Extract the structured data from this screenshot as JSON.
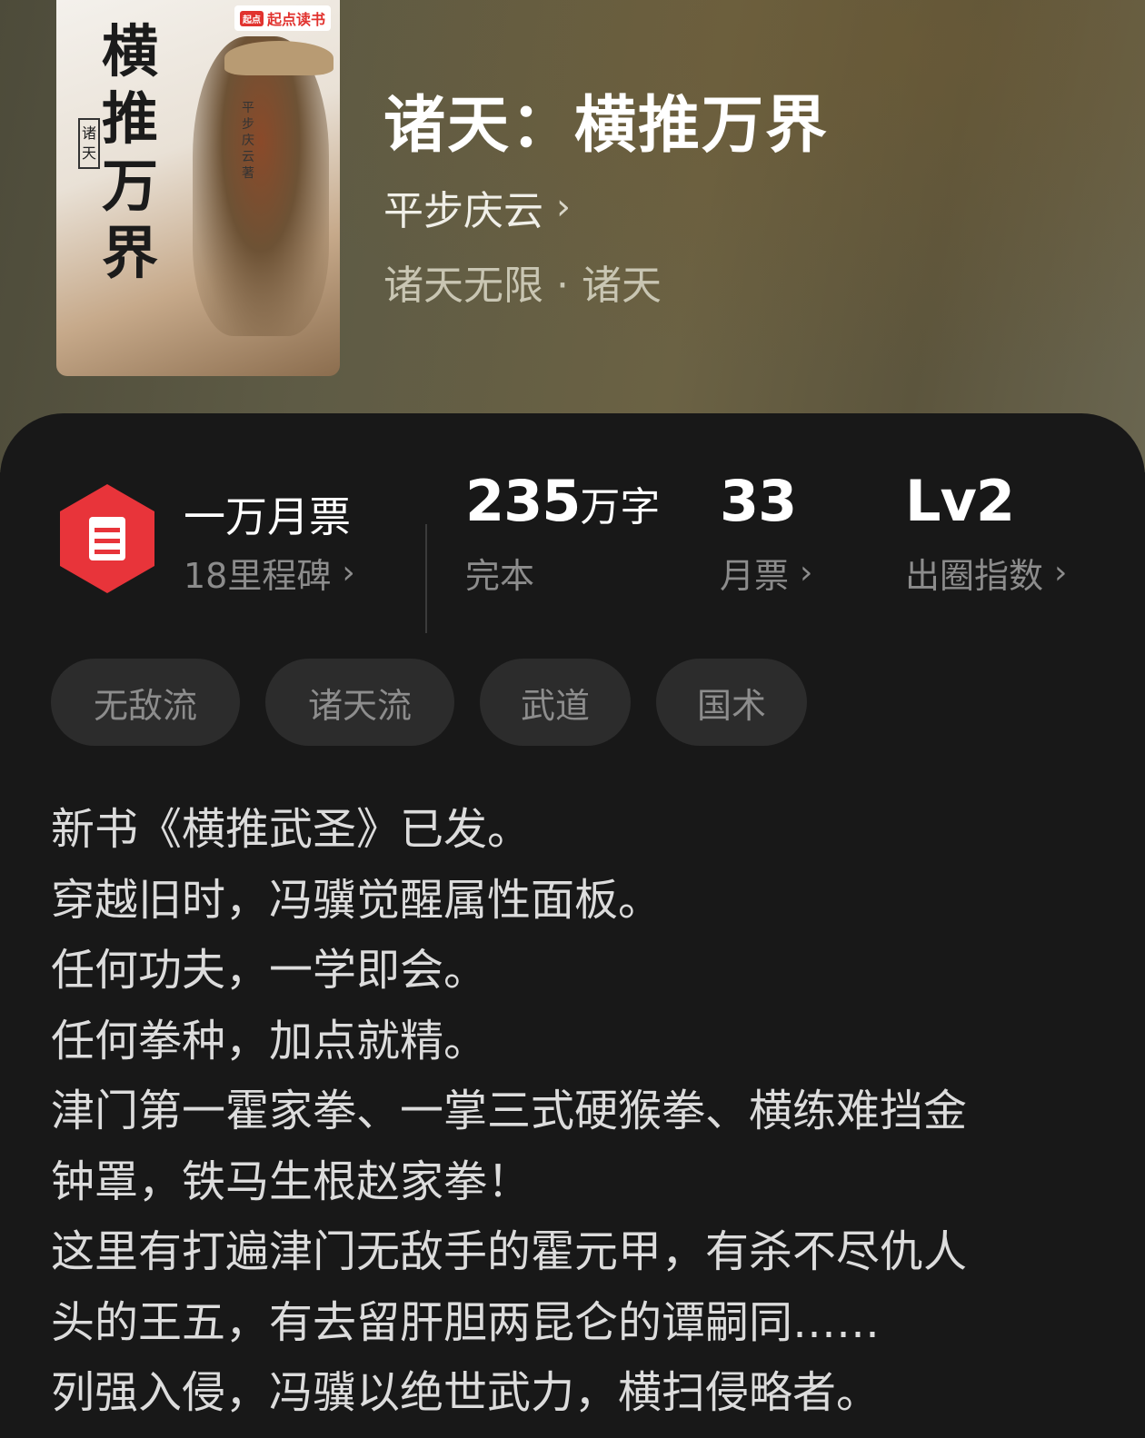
{
  "book": {
    "title": "诸天：横推万界",
    "author": "平步庆云",
    "author_chevron": "›",
    "genre": "诸天无限 · 诸天"
  },
  "cover": {
    "calligraphy": "横推万界",
    "small_title": "诸天",
    "author_vertical": "平步庆云 著",
    "badge_mark": "起点",
    "badge_text": "起点读书"
  },
  "stats": {
    "ticket": {
      "label": "一万月票",
      "sub": "18里程碑",
      "chevron": "›"
    },
    "words": {
      "number": "235",
      "unit": "万字",
      "sub": "完本"
    },
    "monthly": {
      "number": "33",
      "sub": "月票",
      "chevron": "›"
    },
    "index": {
      "number": "Lv2",
      "sub": "出圈指数",
      "chevron": "›"
    }
  },
  "tags": [
    "无敌流",
    "诸天流",
    "武道",
    "国术"
  ],
  "description": [
    "新书《横推武圣》已发。",
    "穿越旧时，冯骥觉醒属性面板。",
    "任何功夫，一学即会。",
    "任何拳种，加点就精。",
    "津门第一霍家拳、一掌三式硬猴拳、横练难挡金",
    "钟罩，铁马生根赵家拳！",
    "这里有打遍津门无敌手的霍元甲，有杀不尽仇人",
    "头的王五，有去留肝胆两昆仑的谭嗣同……",
    "列强入侵，冯骥以绝世武力，横扫侵略者。"
  ],
  "colors": {
    "background": "#181818",
    "ticket_red": "#e8343a",
    "tag_bg": "#2c2c2c"
  }
}
